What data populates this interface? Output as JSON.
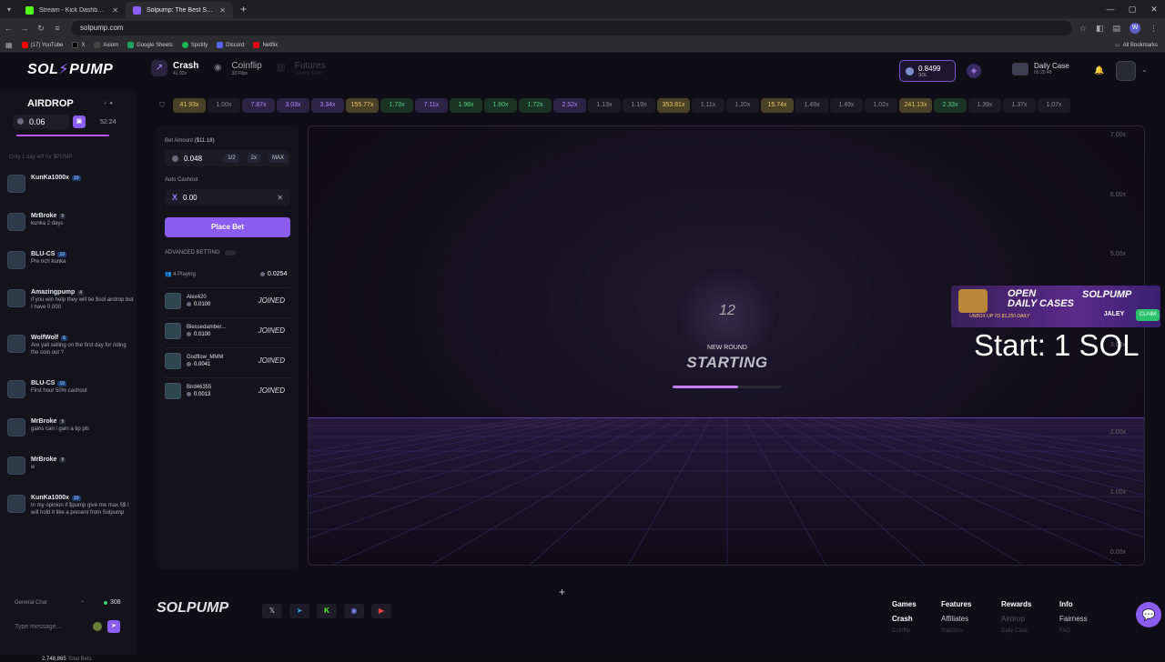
{
  "browser": {
    "tabs": [
      {
        "title": "Stream - Kick Dashboard",
        "color": "#53fc18",
        "active": false
      },
      {
        "title": "Solpump: The Best Solana Casi...",
        "color": "#8a5cf0",
        "active": true
      }
    ],
    "url": "solpump.com",
    "profile_initial": "W",
    "bookmarks": [
      {
        "label": "(17) YouTube",
        "color": "#ff0000"
      },
      {
        "label": "X",
        "color": "#000000"
      },
      {
        "label": "Axiom",
        "color": "#444444"
      },
      {
        "label": "Google Sheets",
        "color": "#1fa463"
      },
      {
        "label": "Spotify",
        "color": "#1db954"
      },
      {
        "label": "Discord",
        "color": "#5865f2"
      },
      {
        "label": "Netflix",
        "color": "#e50914"
      }
    ],
    "all_bookmarks": "All Bookmarks"
  },
  "header": {
    "logo_left": "SOL",
    "logo_right": "PUMP",
    "nav": [
      {
        "label": "Crash",
        "sub": "41.93x"
      },
      {
        "label": "Coinflip",
        "sub": "33 Flips"
      },
      {
        "label": "Futures",
        "sub": "Trading Soon"
      }
    ],
    "balance_value": "0.8499",
    "balance_unit": "SOL",
    "daily_case_title": "Daily Case",
    "daily_case_sub": "00:20:48"
  },
  "airdrop": {
    "title": "AIRDROP",
    "amount": "0.06",
    "timer": "52:24",
    "progress": 0.85
  },
  "chat": {
    "note": "Only 1 day left for $PUMP",
    "messages": [
      {
        "name": "KunKa1000x",
        "level": "10",
        "text": "",
        "blue": true
      },
      {
        "name": "MrBroke",
        "level": "9",
        "text": "kunka 2 days",
        "blue": false
      },
      {
        "name": "BLU-CS",
        "level": "10",
        "text": "Pre rich kunka",
        "blue": true
      },
      {
        "name": "Amazingpump",
        "level": "4",
        "text": "if you win help they will be $sol airdrop but I have 0.000",
        "blue": false
      },
      {
        "name": "WolfWolf",
        "level": "6",
        "text": "Are yall selling on the first day for riding the coin out ?",
        "blue": true
      },
      {
        "name": "BLU-CS",
        "level": "10",
        "text": "First hour 50% cashout",
        "blue": true
      },
      {
        "name": "MrBroke",
        "level": "9",
        "text": "gains can i gain a tip pls",
        "blue": false
      },
      {
        "name": "MrBroke",
        "level": "9",
        "text": "w",
        "blue": false
      },
      {
        "name": "KunKa1000x",
        "level": "10",
        "text": "In my opinion if $pump give me max 5$ I will hold it like a present from Solpump",
        "blue": true
      }
    ],
    "channel": "General Chat",
    "online_count": "308",
    "input_placeholder": "Type message...",
    "total_bets_value": "2,748,865",
    "total_bets_label": "Total Bets"
  },
  "history": [
    {
      "v": "41.93x",
      "bg": "#4a4226",
      "fg": "#e6c86a"
    },
    {
      "v": "1.00x",
      "bg": "#1c1b24",
      "fg": "#888888"
    },
    {
      "v": "7.87x",
      "bg": "#2d2345",
      "fg": "#b08cff"
    },
    {
      "v": "3.03x",
      "bg": "#2d2345",
      "fg": "#b08cff"
    },
    {
      "v": "3.34x",
      "bg": "#2d2345",
      "fg": "#b08cff"
    },
    {
      "v": "155.77x",
      "bg": "#4a4226",
      "fg": "#e6c86a"
    },
    {
      "v": "1.73x",
      "bg": "#1b3325",
      "fg": "#55d080"
    },
    {
      "v": "7.11x",
      "bg": "#2d2345",
      "fg": "#b08cff"
    },
    {
      "v": "1.98x",
      "bg": "#1b3325",
      "fg": "#55d080"
    },
    {
      "v": "1.80x",
      "bg": "#1b3325",
      "fg": "#55d080"
    },
    {
      "v": "1.72x",
      "bg": "#1b3325",
      "fg": "#55d080"
    },
    {
      "v": "2.52x",
      "bg": "#2d2345",
      "fg": "#b08cff"
    },
    {
      "v": "1.13x",
      "bg": "#1c1b24",
      "fg": "#888888"
    },
    {
      "v": "1.19x",
      "bg": "#1c1b24",
      "fg": "#888888"
    },
    {
      "v": "353.81x",
      "bg": "#4a4226",
      "fg": "#e6c86a"
    },
    {
      "v": "1.11x",
      "bg": "#1c1b24",
      "fg": "#888888"
    },
    {
      "v": "1.20x",
      "bg": "#1c1b24",
      "fg": "#888888"
    },
    {
      "v": "15.74x",
      "bg": "#4a4226",
      "fg": "#e6c86a"
    },
    {
      "v": "1.49x",
      "bg": "#1c1b24",
      "fg": "#888888"
    },
    {
      "v": "1.49x",
      "bg": "#1c1b24",
      "fg": "#888888"
    },
    {
      "v": "1.02x",
      "bg": "#1c1b24",
      "fg": "#888888"
    },
    {
      "v": "241.13x",
      "bg": "#4a4226",
      "fg": "#e6c86a"
    },
    {
      "v": "2.33x",
      "bg": "#1b3325",
      "fg": "#55d080"
    },
    {
      "v": "1.39x",
      "bg": "#1c1b24",
      "fg": "#888888"
    },
    {
      "v": "1.37x",
      "bg": "#1c1b24",
      "fg": "#888888"
    },
    {
      "v": "1.07x",
      "bg": "#1c1b24",
      "fg": "#888888"
    }
  ],
  "bet": {
    "amount_label": "Bet Amount",
    "amount_usd": "($11.18)",
    "amount": "0.048",
    "half": "1/2",
    "double": "2x",
    "max": "MAX",
    "auto_label": "Auto Cashout",
    "auto_value": "0.00",
    "place_label": "Place Bet",
    "advanced_label": "ADVANCED BETTING",
    "playing_label": "4 Playing",
    "pot": "0.0254",
    "players": [
      {
        "name": "Alex420",
        "bet": "0.0100",
        "status": "JOINED"
      },
      {
        "name": "Blessedamber...",
        "bet": "0.0100",
        "status": "JOINED"
      },
      {
        "name": "Godflow_MMM",
        "bet": "0.0041",
        "status": "JOINED"
      },
      {
        "name": "Bird46355",
        "bet": "0.0013",
        "status": "JOINED"
      }
    ]
  },
  "game": {
    "countdown": "12",
    "new_round": "NEW ROUND",
    "starting": "STARTING",
    "progress": 0.6,
    "y_ticks": [
      "7.00x",
      "6.00x",
      "5.00x",
      "3.00x",
      "2.00x",
      "1.00x",
      "0.00x"
    ]
  },
  "promo": {
    "open": "OPEN",
    "daily_cases": "DAILY CASES",
    "unbox": "UNBOX UP TO $1,250 DAILY",
    "logo": "SOLPUMP",
    "code": "JALEY",
    "claim": "CLAIM"
  },
  "overlay_text": "Start: 1 SOL",
  "footer": {
    "logo": "SOLPUMP",
    "columns": [
      {
        "head": "Games",
        "item": "Crash",
        "item2": "Coinflip"
      },
      {
        "head": "Features",
        "item": "Affiliates",
        "item2": "Statistics"
      },
      {
        "head": "Rewards",
        "item": "Airdrop",
        "item2": "Daily Case"
      },
      {
        "head": "Info",
        "item": "Fairness",
        "item2": "FAQ"
      }
    ]
  }
}
